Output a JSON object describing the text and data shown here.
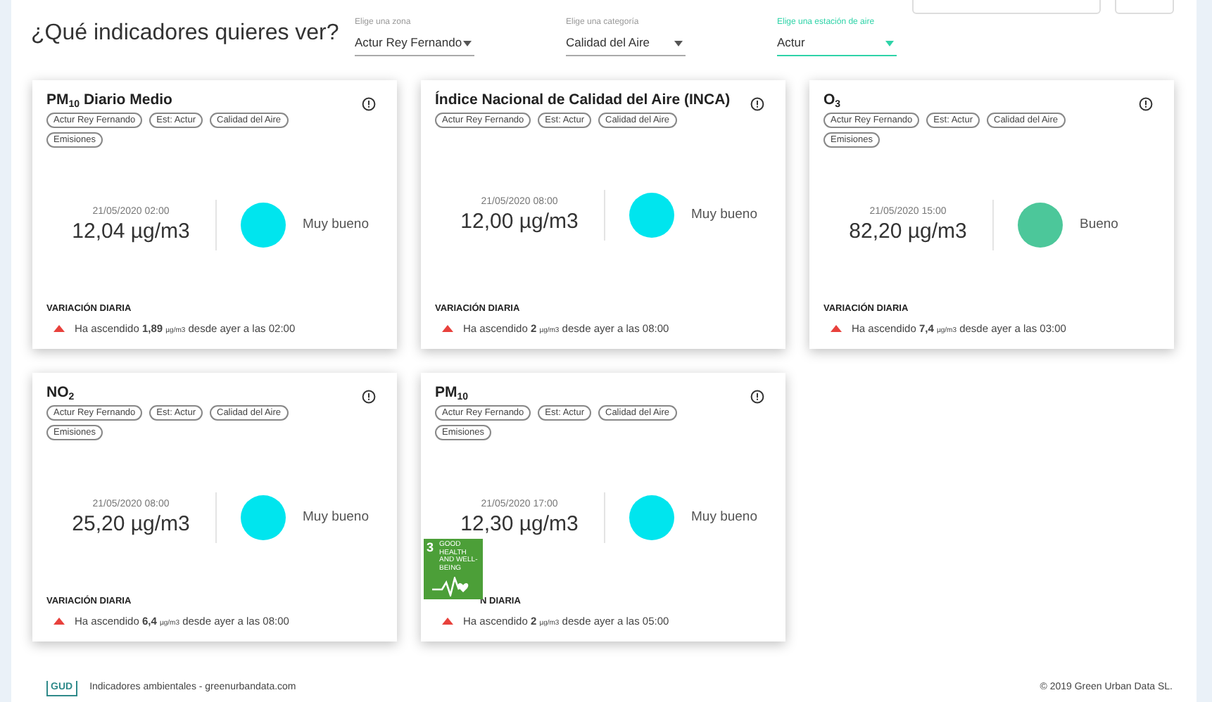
{
  "header": {
    "title": "¿Qué indicadores quieres ver?",
    "filters": [
      {
        "label": "Elige una zona",
        "value": "Actur Rey Fernando",
        "focused": false
      },
      {
        "label": "Elige una categoría",
        "value": "Calidad del Aire",
        "focused": false
      },
      {
        "label": "Elige una estación de aire",
        "value": "Actur",
        "focused": true
      }
    ]
  },
  "cards": [
    {
      "title": "PM$_{10}$ Diario Medio",
      "tags": [
        "Actur Rey Fernando",
        "Est: Actur",
        "Calidad del Aire",
        "Emisiones"
      ],
      "datetime": "21/05/2020 02:00",
      "value": "12,04 µg/m3",
      "color": "#00e5ee",
      "quality": "Muy bueno",
      "variation_label": "VARIACIÓN DIARIA",
      "variation": "Ha ascendido **1,89** $_{µg/m3}$ desde ayer a las 02:00"
    },
    {
      "title": "Índice Nacional de Calidad del Aire (INCA)",
      "tags": [
        "Actur Rey Fernando",
        "Est: Actur",
        "Calidad del Aire"
      ],
      "datetime": "21/05/2020 08:00",
      "value": "12,00 µg/m3",
      "color": "#00e5ee",
      "quality": "Muy bueno",
      "variation_label": "VARIACIÓN DIARIA",
      "variation": "Ha ascendido **2** $_{µg/m3}$ desde ayer a las 08:00"
    },
    {
      "title": "O$_{3}$",
      "tags": [
        "Actur Rey Fernando",
        "Est: Actur",
        "Calidad del Aire",
        "Emisiones"
      ],
      "datetime": "21/05/2020 15:00",
      "value": "82,20 µg/m3",
      "color": "#4cc79a",
      "quality": "Bueno",
      "variation_label": "VARIACIÓN DIARIA",
      "variation": "Ha ascendido **7,4** $_{µg/m3}$ desde ayer a las 03:00"
    },
    {
      "title": "NO$_{2}$",
      "tags": [
        "Actur Rey Fernando",
        "Est: Actur",
        "Calidad del Aire",
        "Emisiones"
      ],
      "datetime": "21/05/2020 08:00",
      "value": "25,20 µg/m3",
      "color": "#00e5ee",
      "quality": "Muy bueno",
      "variation_label": "VARIACIÓN DIARIA",
      "variation": "Ha ascendido **6,4** $_{µg/m3}$ desde ayer a las 08:00"
    },
    {
      "title": "PM$_{10}$",
      "tags": [
        "Actur Rey Fernando",
        "Est: Actur",
        "Calidad del Aire",
        "Emisiones"
      ],
      "datetime": "21/05/2020 17:00",
      "value": "12,30 µg/m3",
      "color": "#00e5ee",
      "quality": "Muy bueno",
      "variation_label": "N DIARIA",
      "variation": "Ha ascendido **2** $_{µg/m3}$ desde ayer a las 05:00",
      "badge": {
        "number": "3",
        "label": "GOOD HEALTH AND WELL-BEING"
      }
    }
  ],
  "footer": {
    "logo": "GUD",
    "text": "Indicadores ambientales - greenurbandata.com",
    "copyright": "© 2019 Green Urban Data SL."
  }
}
